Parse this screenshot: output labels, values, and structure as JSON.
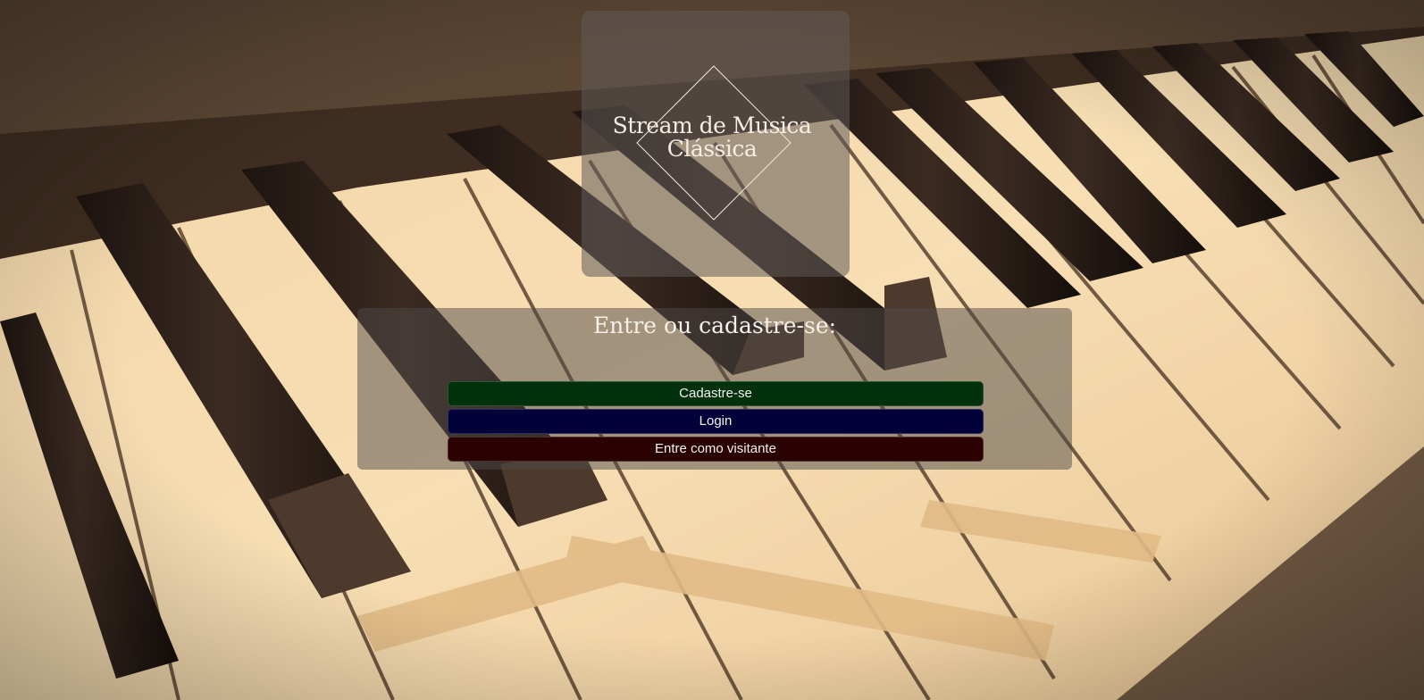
{
  "logo": {
    "line1": "Stream de Musica",
    "line2": "Clássica"
  },
  "auth": {
    "heading": "Entre ou cadastre-se:",
    "signup_label": "Cadastre-se",
    "login_label": "Login",
    "guest_label": "Entre como visitante"
  },
  "colors": {
    "signup_button": "#01310a",
    "login_button": "#02013a",
    "guest_button": "#2a0202",
    "text": "#f4ede4"
  },
  "icons": {
    "logo_mark": "diamond-outline-icon"
  }
}
